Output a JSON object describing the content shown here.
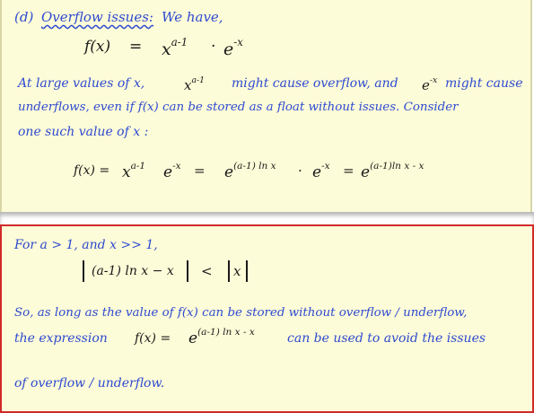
{
  "note1": {
    "heading_label": "(d)",
    "heading_title": "Overflow issues:",
    "heading_rest": "We have,",
    "def_lhs": "f(x)",
    "def_eq": "=",
    "def_base1": "x",
    "def_exp1": "a-1",
    "def_dot": "·",
    "def_base2": "e",
    "def_exp2": "-x",
    "para_line1_a": "At large values of x,",
    "para_line1_x": "x",
    "para_line1_xexp": "a-1",
    "para_line1_b": "might cause overflow, and",
    "para_line1_e": "e",
    "para_line1_eexp": "-x",
    "para_line1_c": "might cause",
    "para_line2": "underflows, even if f(x) can be stored as a float without issues. Consider",
    "para_line3": "one such value of x :",
    "eq_lhs": "f(x) =",
    "eq_x": "x",
    "eq_xexp": "a-1",
    "eq_e1": "e",
    "eq_e1exp": "-x",
    "eq_eq1": "=",
    "eq_e2": "e",
    "eq_e2exp": "(a-1) ln x",
    "eq_dot": "·",
    "eq_e3": "e",
    "eq_e3exp": "-x",
    "eq_eq2": "=",
    "eq_e4": "e",
    "eq_e4exp": "(a-1)ln x - x"
  },
  "note2": {
    "cond": "For a > 1, and x >> 1,",
    "ineq_left": "(a-1) ln x − x",
    "ineq_op": "<",
    "ineq_right": "x",
    "line1": "So, as long as the value of f(x) can be stored without overflow / underflow,",
    "line2_a": "the expression",
    "line2_f": "f(x) =",
    "line2_e": "e",
    "line2_eexp": "(a-1) ln x - x",
    "line2_b": "can be used to avoid the issues",
    "line3": "of overflow / underflow."
  },
  "colors": {
    "note_bg": "#fdfcd8",
    "frame": "#d12a2a",
    "ink_blue": "#2f4ad0",
    "ink_black": "#1a1a1a"
  }
}
